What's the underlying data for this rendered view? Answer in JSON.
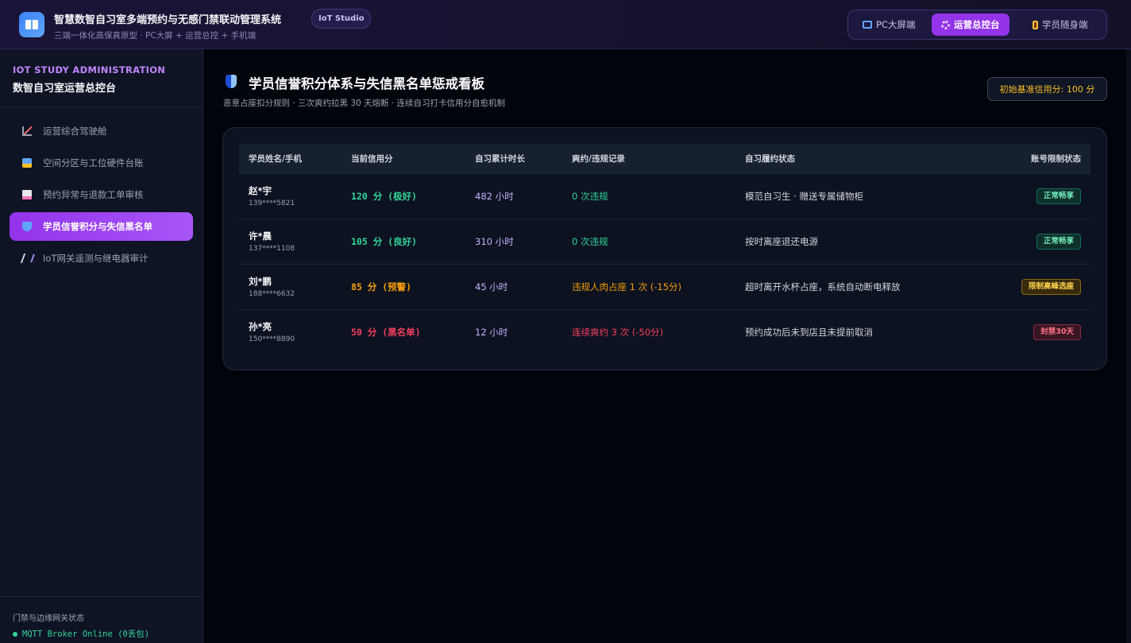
{
  "header": {
    "title": "智慧数智自习室多端预约与无感门禁联动管理系统",
    "badge": "IoT Studio",
    "subtitle": "三端一体化高保真原型 · PC大屏 + 运营总控 + 手机端",
    "views": [
      {
        "label": "PC大屏端",
        "icon": "monitor-icon",
        "active": false
      },
      {
        "label": "运营总控台",
        "icon": "gear-icon",
        "active": true
      },
      {
        "label": "学员随身端",
        "icon": "phone-icon",
        "active": false
      }
    ]
  },
  "sidebar": {
    "eyebrow": "IOT STUDY ADMINISTRATION",
    "title": "数智自习室运营总控台",
    "items": [
      {
        "label": "运营综合驾驶舱",
        "icon": "chart-icon"
      },
      {
        "label": "空间分区与工位硬件台账",
        "icon": "desk-icon"
      },
      {
        "label": "预约异常与退款工单审核",
        "icon": "document-icon"
      },
      {
        "label": "学员信誉积分与失信黑名单",
        "icon": "shield-icon",
        "active": true
      },
      {
        "label": "IoT网关遥测与继电器审计",
        "icon": "antenna-icon"
      }
    ],
    "gateway_label": "门禁与边缘网关状态",
    "gateway_status": "MQTT Broker Online (0丢包)"
  },
  "main": {
    "title": "学员信誉积分体系与失信黑名单惩戒看板",
    "subtitle": "恶意占座扣分规则 · 三次爽约拉黑 30 天熔断 · 连续自习打卡信用分自愈机制",
    "base_score": "初始基准信用分: 100 分",
    "table": {
      "headers": [
        "学员姓名/手机",
        "当前信用分",
        "自习累计时长",
        "爽约/违规记录",
        "自习履约状态",
        "账号限制状态"
      ],
      "rows": [
        {
          "name": "赵*宇",
          "phone": "139****5821",
          "score": "120 分 (极好)",
          "hours": "482 小时",
          "record": "0 次违规",
          "status": "模范自习生 · 赠送专属储物柜",
          "restriction": "正常畅享",
          "level": "ok"
        },
        {
          "name": "许*晨",
          "phone": "137****1108",
          "score": "105 分 (良好)",
          "hours": "310 小时",
          "record": "0 次违规",
          "status": "按时离座退还电源",
          "restriction": "正常畅享",
          "level": "ok"
        },
        {
          "name": "刘*鹏",
          "phone": "188****6632",
          "score": "85 分 (预警)",
          "hours": "45 小时",
          "record": "违规人肉占座 1 次 (-15分)",
          "status": "超时离开水杯占座，系统自动断电释放",
          "restriction": "限制高峰选座",
          "level": "warn"
        },
        {
          "name": "孙*亮",
          "phone": "150****8890",
          "score": "50 分 (黑名单)",
          "hours": "12 小时",
          "record": "连续爽约 3 次 (-50分)",
          "status": "预约成功后未到店且未提前取消",
          "restriction": "封禁30天",
          "level": "ban"
        }
      ]
    }
  },
  "colors": {
    "accent": "#9333ea",
    "good": "#34d399",
    "warn": "#f59e0b",
    "danger": "#f43f5e"
  }
}
